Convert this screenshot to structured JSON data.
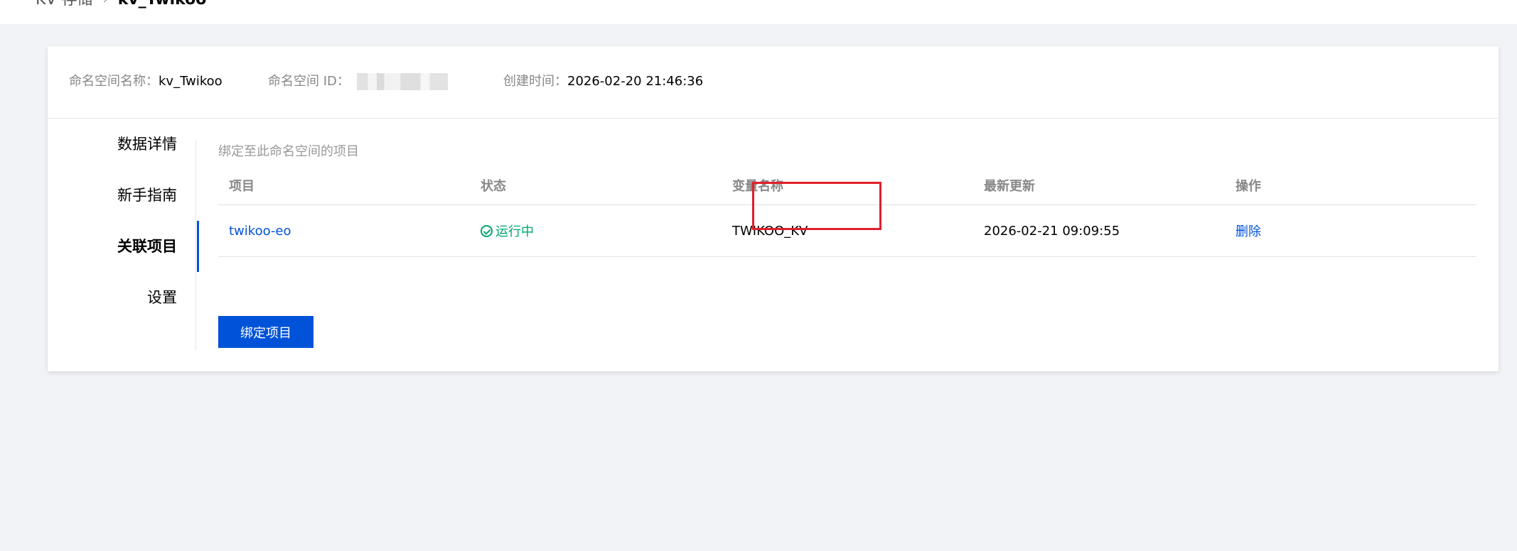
{
  "breadcrumb": {
    "parent": "KV 存储",
    "separator": "›",
    "current": "kv_Twikoo"
  },
  "info": {
    "name_label": "命名空间名称：",
    "name_value": "kv_Twikoo",
    "id_label": "命名空间 ID：",
    "created_label": "创建时间：",
    "created_value": "2026-02-20 21:46:36"
  },
  "nav": {
    "items": [
      {
        "label": "数据详情"
      },
      {
        "label": "新手指南"
      },
      {
        "label": "关联项目"
      },
      {
        "label": "设置"
      }
    ],
    "active_index": 2
  },
  "section": {
    "title": "绑定至此命名空间的项目"
  },
  "table": {
    "headers": [
      "项目",
      "状态",
      "变量名称",
      "最新更新",
      "操作"
    ],
    "rows": [
      {
        "project": "twikoo-eo",
        "status": "运行中",
        "variable": "TWIKOO_KV",
        "updated": "2026-02-21 09:09:55",
        "action": "删除"
      }
    ]
  },
  "bind_button": {
    "label": "绑定项目"
  },
  "colors": {
    "accent": "#0052d9",
    "success": "#00a870",
    "highlight": "#e0202a",
    "background": "#f2f3f7"
  }
}
